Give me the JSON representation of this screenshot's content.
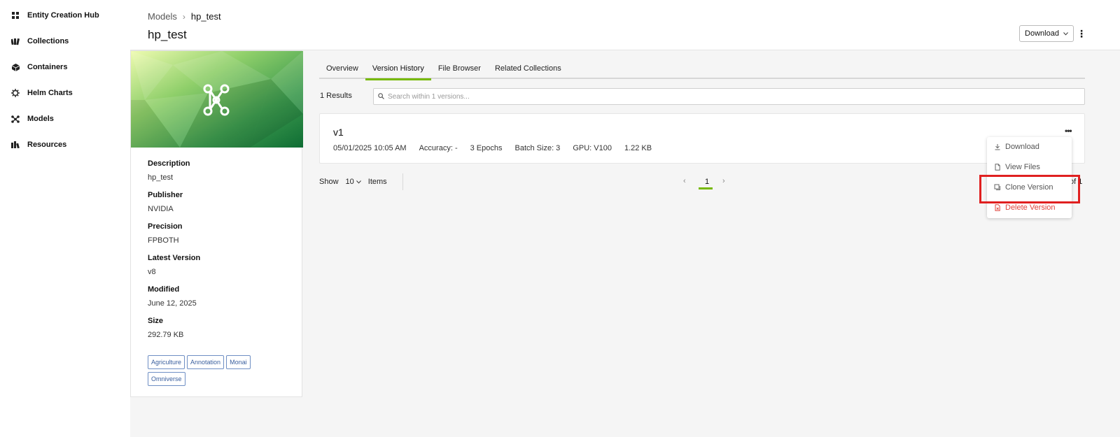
{
  "sidebar": {
    "items": [
      {
        "label": "Entity Creation Hub",
        "icon": "grid-icon"
      },
      {
        "label": "Collections",
        "icon": "collections-icon"
      },
      {
        "label": "Containers",
        "icon": "cube-icon"
      },
      {
        "label": "Helm Charts",
        "icon": "helm-icon"
      },
      {
        "label": "Models",
        "icon": "models-icon"
      },
      {
        "label": "Resources",
        "icon": "resources-icon"
      }
    ]
  },
  "header": {
    "breadcrumb": {
      "parent": "Models",
      "separator": "›",
      "current": "hp_test"
    },
    "title": "hp_test",
    "download_label": "Download",
    "kebab": "⋮"
  },
  "details": {
    "description_label": "Description",
    "description_value": "hp_test",
    "publisher_label": "Publisher",
    "publisher_value": "NVIDIA",
    "precision_label": "Precision",
    "precision_value": "FPBOTH",
    "latest_version_label": "Latest Version",
    "latest_version_value": "v8",
    "modified_label": "Modified",
    "modified_value": "June 12, 2025",
    "size_label": "Size",
    "size_value": "292.79 KB",
    "tags": [
      "Agriculture",
      "Annotation",
      "Monai",
      "Omniverse"
    ]
  },
  "tabs": [
    "Overview",
    "Version History",
    "File Browser",
    "Related Collections"
  ],
  "active_tab": "Version History",
  "results": {
    "count_label": "1 Results",
    "search_placeholder": "Search within 1 versions..."
  },
  "version": {
    "name": "v1",
    "date": "05/01/2025 10:05 AM",
    "accuracy": "Accuracy: -",
    "epochs": "3 Epochs",
    "batch_size": "Batch Size: 3",
    "gpu": "GPU: V100",
    "size": "1.22 KB",
    "kebab": "•••"
  },
  "pager": {
    "show_label": "Show",
    "page_size": "10",
    "items_label": "Items",
    "prev": "‹",
    "current_page": "1",
    "next": "›",
    "of_text": "of 1"
  },
  "menu": {
    "download": "Download",
    "view_files": "View Files",
    "clone_version": "Clone Version",
    "delete_version": "Delete Version"
  },
  "colors": {
    "accent": "#76b900",
    "danger": "#e0433c",
    "highlight": "#e02020",
    "tag_border": "#6f8fc4"
  }
}
